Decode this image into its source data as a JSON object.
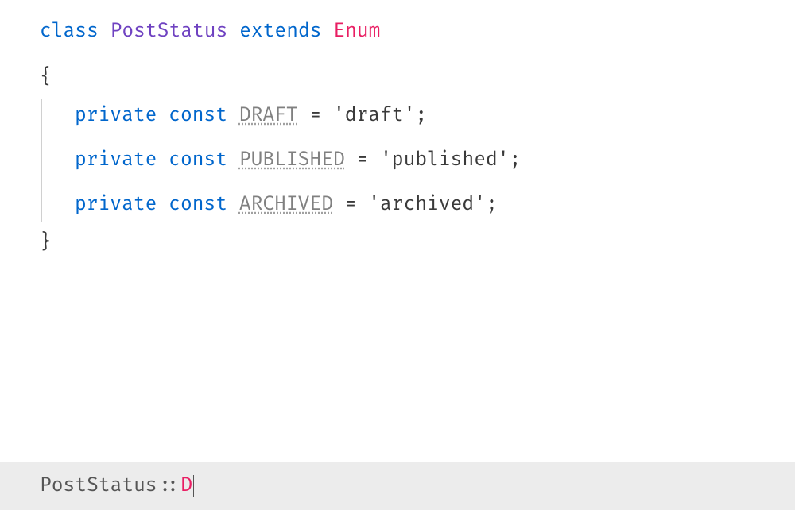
{
  "code": {
    "class_keyword": "class",
    "class_name": "PostStatus",
    "extends_keyword": "extends",
    "parent_class": "Enum",
    "open_brace": "{",
    "close_brace": "}",
    "constants": [
      {
        "visibility": "private",
        "const_kw": "const",
        "name": "DRAFT",
        "equals": " = ",
        "value": "'draft'",
        "semi": ";"
      },
      {
        "visibility": "private",
        "const_kw": "const",
        "name": "PUBLISHED",
        "equals": " = ",
        "value": "'published'",
        "semi": ";"
      },
      {
        "visibility": "private",
        "const_kw": "const",
        "name": "ARCHIVED",
        "equals": " = ",
        "value": "'archived'",
        "semi": ";"
      }
    ]
  },
  "typing": {
    "class_ref": "PostStatus",
    "scope": "::",
    "char": "D"
  }
}
